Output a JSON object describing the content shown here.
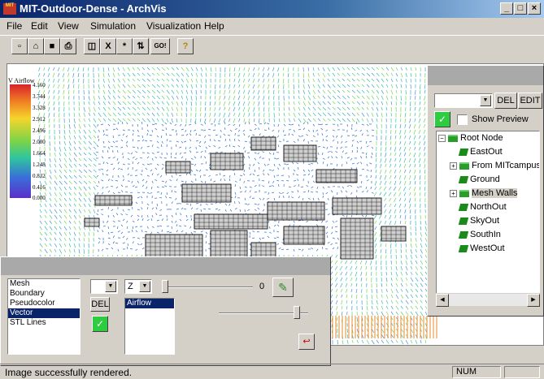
{
  "window": {
    "title": "MIT-Outdoor-Dense - ArchVis",
    "app_icon_text": "MIT"
  },
  "window_buttons": {
    "minimize": "_",
    "maximize": "□",
    "close": "×"
  },
  "menu": [
    "File",
    "Edit",
    "View",
    "Simulation",
    "Visualization",
    "Help"
  ],
  "toolbar": [
    {
      "name": "new-icon",
      "glyph": "▫"
    },
    {
      "name": "open-icon",
      "glyph": "⌂"
    },
    {
      "name": "save-icon",
      "glyph": "■"
    },
    {
      "name": "print-icon",
      "glyph": "⎙"
    },
    {
      "name": "box-icon",
      "glyph": "◫"
    },
    {
      "name": "x-icon",
      "glyph": "X"
    },
    {
      "name": "star-icon",
      "glyph": "*"
    },
    {
      "name": "scale-icon",
      "glyph": "⇅"
    },
    {
      "name": "go-icon",
      "glyph": "GO!"
    },
    {
      "name": "help-icon",
      "glyph": "?"
    }
  ],
  "legend": {
    "title": "V Airflow",
    "values": [
      "4.160",
      "3.744",
      "3.328",
      "2.912",
      "2.496",
      "2.080",
      "1.664",
      "1.248",
      "0.832",
      "0.416",
      "0.000"
    ]
  },
  "scene_panel": {
    "del_label": "DEL",
    "edit_label": "EDIT",
    "show_preview_label": "Show Preview",
    "tree": [
      {
        "label": "Root Node",
        "level": 0,
        "type": "folder",
        "expander": "−"
      },
      {
        "label": "EastOut",
        "level": 1,
        "type": "object"
      },
      {
        "label": "From MITcampus",
        "level": 1,
        "type": "folder",
        "expander": "+"
      },
      {
        "label": "Ground",
        "level": 1,
        "type": "object"
      },
      {
        "label": "Mesh Walls",
        "level": 1,
        "type": "folder",
        "expander": "+",
        "selected": true
      },
      {
        "label": "NorthOut",
        "level": 1,
        "type": "object"
      },
      {
        "label": "SkyOut",
        "level": 1,
        "type": "object"
      },
      {
        "label": "SouthIn",
        "level": 1,
        "type": "object"
      },
      {
        "label": "WestOut",
        "level": 1,
        "type": "object"
      }
    ]
  },
  "vis_panel": {
    "layers": [
      "Mesh",
      "Boundary",
      "Pseudocolor",
      "Vector",
      "STL Lines"
    ],
    "selected_layer": "Vector",
    "axis_value": "Z",
    "slider_value": "0",
    "del_label": "DEL",
    "variables": [
      "Airflow"
    ],
    "selected_variable": "Airflow"
  },
  "status": {
    "message": "Image successfully rendered.",
    "num": "NUM"
  },
  "colors": {
    "selection": "#0a246a",
    "accent_green": "#2ecc40"
  }
}
